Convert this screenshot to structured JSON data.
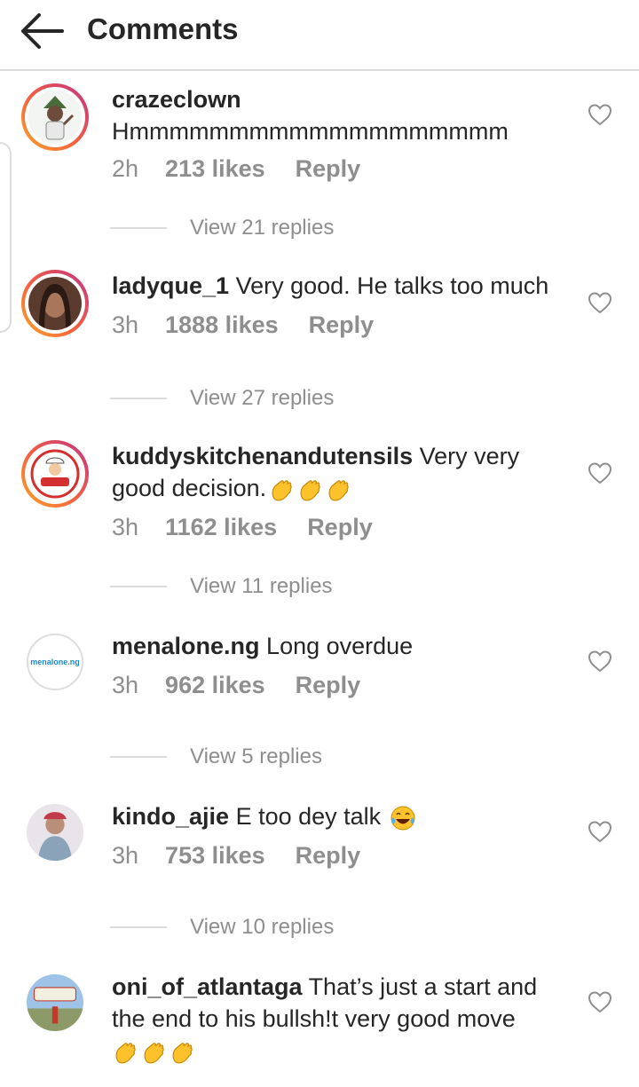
{
  "header": {
    "title": "Comments",
    "back_icon": "arrow-left-icon"
  },
  "comments": [
    {
      "username": "crazeclown",
      "text": "Hmmmmmmmmmmmmmmmmmmm",
      "time": "2h",
      "likes": "213 likes",
      "reply": "Reply",
      "view_replies": "View 21 replies",
      "avatar_ring": true
    },
    {
      "username": "ladyque_1",
      "text": "Very good. He talks too much",
      "time": "3h",
      "likes": "1888 likes",
      "reply": "Reply",
      "view_replies": "View 27 replies",
      "avatar_ring": true
    },
    {
      "username": "kuddyskitchenandutensils",
      "text": "Very very good decision.",
      "emojis": "clapping-hands x3",
      "time": "3h",
      "likes": "1162 likes",
      "reply": "Reply",
      "view_replies": "View 11 replies",
      "avatar_ring": true
    },
    {
      "username": "menalone.ng",
      "text": "Long overdue",
      "avatar_text": "menalone.ng",
      "time": "3h",
      "likes": "962 likes",
      "reply": "Reply",
      "view_replies": "View 5 replies",
      "avatar_ring": false
    },
    {
      "username": "kindo_ajie",
      "text": "E too dey talk",
      "emojis": "tears-of-joy",
      "time": "3h",
      "likes": "753 likes",
      "reply": "Reply",
      "view_replies": "View 10 replies",
      "avatar_ring": false
    },
    {
      "username": "oni_of_atlantaga",
      "text": "That’s just a start and the end to his bullsh!t very good move",
      "emojis": "clapping-hands x3",
      "avatar_ring": false
    }
  ],
  "colors": {
    "text": "#262626",
    "secondary": "#8e8e8e",
    "divider": "#dbdbdb",
    "ring_start": "#f9a825",
    "ring_end": "#c13584"
  }
}
